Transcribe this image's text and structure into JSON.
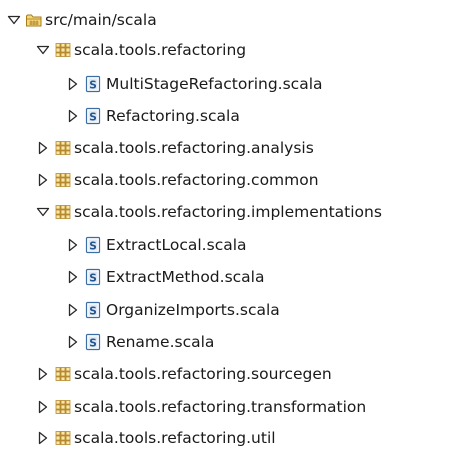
{
  "tree": {
    "root": {
      "label": "src/main/scala"
    },
    "pkg_tools_refactoring": {
      "label": "scala.tools.refactoring"
    },
    "file_multistage": {
      "label": "MultiStageRefactoring.scala"
    },
    "file_refactoring": {
      "label": "Refactoring.scala"
    },
    "pkg_analysis": {
      "label": "scala.tools.refactoring.analysis"
    },
    "pkg_common": {
      "label": "scala.tools.refactoring.common"
    },
    "pkg_implementations": {
      "label": "scala.tools.refactoring.implementations"
    },
    "file_extractlocal": {
      "label": "ExtractLocal.scala"
    },
    "file_extractmethod": {
      "label": "ExtractMethod.scala"
    },
    "file_organizeimports": {
      "label": "OrganizeImports.scala"
    },
    "file_rename": {
      "label": "Rename.scala"
    },
    "pkg_sourcegen": {
      "label": "scala.tools.refactoring.sourcegen"
    },
    "pkg_transformation": {
      "label": "scala.tools.refactoring.transformation"
    },
    "pkg_util": {
      "label": "scala.tools.refactoring.util"
    }
  },
  "icons": {
    "expanded": "triangle-down-icon",
    "collapsed": "triangle-right-icon",
    "source_folder": "source-folder-icon",
    "package": "package-icon",
    "scala_file": "scala-file-icon"
  },
  "colors": {
    "package_icon": "#b5892e",
    "scala_file_icon": "#3a6ea5",
    "source_folder_icon": "#e8b84a",
    "twisty": "#2a2a2a"
  }
}
